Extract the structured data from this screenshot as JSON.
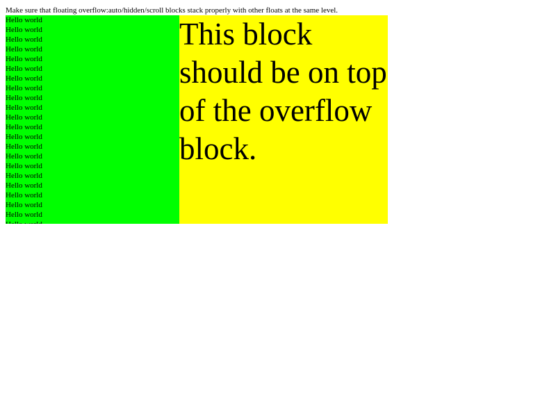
{
  "description_line": "Make sure that floating overflow:auto/hidden/scroll blocks stack properly with other floats at the same level.",
  "overflow_block": {
    "line_text": "Hello world",
    "line_count": 22,
    "color": "#00ff00"
  },
  "plain_block": {
    "text": "This block should be on top of the overflow block.",
    "color": "#ffff00"
  }
}
